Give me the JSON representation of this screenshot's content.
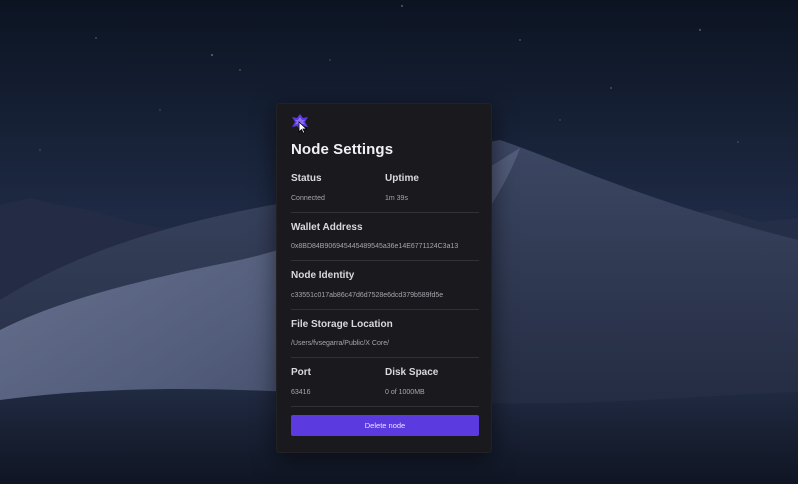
{
  "panel": {
    "title": "Node Settings",
    "logo_icon": "x-core-logo-icon",
    "accent_color": "#5b3ae0",
    "status": {
      "label": "Status",
      "value": "Connected"
    },
    "uptime": {
      "label": "Uptime",
      "value": "1m 39s"
    },
    "wallet_address": {
      "label": "Wallet Address",
      "value": "0x8BD84B906945445489545a36e14E6771124C3a13"
    },
    "node_identity": {
      "label": "Node Identity",
      "value": "c33551c017ab86c47d6d7528e6dcd379b589fd5e"
    },
    "file_storage": {
      "label": "File Storage Location",
      "value": "/Users/fvsegarra/Public/X Core/"
    },
    "port": {
      "label": "Port",
      "value": "63416"
    },
    "disk_space": {
      "label": "Disk Space",
      "value": "0 of 1000MB"
    },
    "delete_button": "Delete node"
  }
}
